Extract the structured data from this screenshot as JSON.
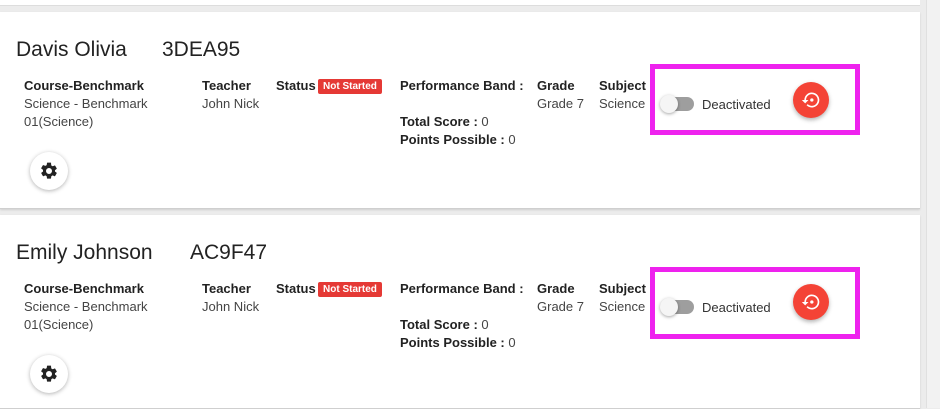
{
  "colors": {
    "accent_red": "#f44336",
    "highlight": "#ee22ee",
    "badge_red": "#e53935"
  },
  "labels": {
    "course_benchmark": "Course-Benchmark",
    "teacher": "Teacher",
    "status": "Status",
    "performance_band": "Performance Band :",
    "grade": "Grade",
    "subject": "Subject",
    "total_score": "Total Score :",
    "points_possible": "Points Possible :"
  },
  "cards": [
    {
      "student_name": "Davis Olivia",
      "code": "3DEA95",
      "course_line1": "Science - Benchmark",
      "course_line2": "01(Science)",
      "teacher": "John Nick",
      "status_badge": "Not Started",
      "total_score": "0",
      "points_possible": "0",
      "grade": "Grade 7",
      "subject": "Science",
      "toggle_label": "Deactivated",
      "icons": {
        "toggle": "toggle-off-icon",
        "reset": "restore-icon",
        "settings": "gear-icon"
      }
    },
    {
      "student_name": "Emily Johnson",
      "code": "AC9F47",
      "course_line1": "Science - Benchmark",
      "course_line2": "01(Science)",
      "teacher": "John Nick",
      "status_badge": "Not Started",
      "total_score": "0",
      "points_possible": "0",
      "grade": "Grade 7",
      "subject": "Science",
      "toggle_label": "Deactivated",
      "icons": {
        "toggle": "toggle-off-icon",
        "reset": "restore-icon",
        "settings": "gear-icon"
      }
    }
  ]
}
